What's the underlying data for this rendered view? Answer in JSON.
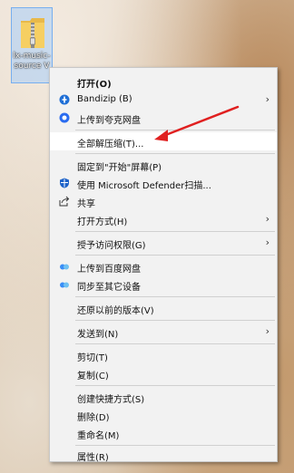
{
  "desktop_icon": {
    "name": "lx-music-source V"
  },
  "menu": {
    "open": "打开(O)",
    "bandizip": "Bandizip (B)",
    "upload_quark": "上传到夸克网盘",
    "extract_all": "全部解压缩(T)...",
    "pin_start": "固定到\"开始\"屏幕(P)",
    "defender": "使用 Microsoft Defender扫描...",
    "share": "共享",
    "open_with": "打开方式(H)",
    "grant_access": "授予访问权限(G)",
    "upload_baidu": "上传到百度网盘",
    "sync_devices": "同步至其它设备",
    "restore_versions": "还原以前的版本(V)",
    "send_to": "发送到(N)",
    "cut": "剪切(T)",
    "copy": "复制(C)",
    "create_shortcut": "创建快捷方式(S)",
    "delete": "删除(D)",
    "rename": "重命名(M)",
    "properties": "属性(R)"
  }
}
